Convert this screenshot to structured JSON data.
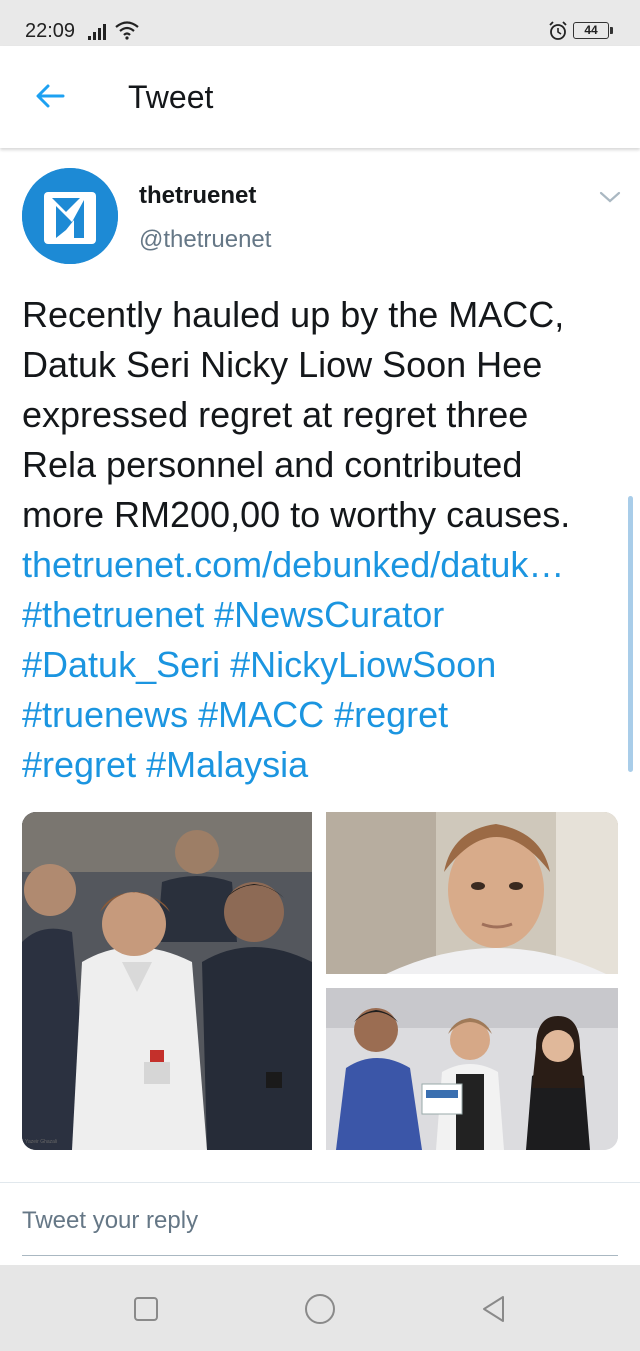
{
  "status_bar": {
    "time": "22:09",
    "battery": "44",
    "icons": [
      "signal-icon",
      "wifi-icon",
      "alarm-icon",
      "battery-icon"
    ]
  },
  "header": {
    "title": "Tweet",
    "back_icon": "arrow-left-icon"
  },
  "tweet": {
    "author": {
      "display_name": "thetruenet",
      "handle": "@thetruenet",
      "avatar_icon": "thetruenet-logo"
    },
    "text_lines": [
      "Recently hauled up by the MACC,",
      "Datuk Seri Nicky Liow Soon Hee",
      "expressed regret at regret three",
      "Rela personnel and contributed",
      "more RM200,00 to worthy causes."
    ],
    "link_lines": [
      "thetruenet.com/debunked/datuk…",
      "#thetruenet #NewsCurator",
      "#Datuk_Seri #NickyLiowSoon",
      "#truenews #MACC #regret",
      "#regret #Malaysia"
    ],
    "photos": [
      {
        "caption": "Yazeir Ghazali"
      },
      {
        "caption": ""
      },
      {
        "caption": ""
      }
    ]
  },
  "reply": {
    "placeholder": "Tweet your reply"
  },
  "colors": {
    "link": "#1b95e0",
    "text": "#14171a",
    "secondary": "#657786",
    "avatar": "#1d8ad5"
  }
}
